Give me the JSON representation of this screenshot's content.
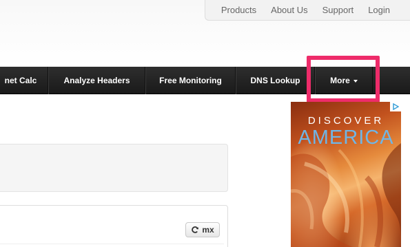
{
  "top_links": {
    "products": "Products",
    "about": "About Us",
    "support": "Support",
    "login": "Login"
  },
  "nav": {
    "subnet_calc": "net Calc",
    "analyze_headers": "Analyze Headers",
    "free_monitoring": "Free Monitoring",
    "dns_lookup": "DNS Lookup",
    "more": "More"
  },
  "toolbar": {
    "mx_label": "mx"
  },
  "ad": {
    "line1": "DISCOVER",
    "line2": "AMERICA"
  },
  "colors": {
    "highlight": "#ee2c6a",
    "navbar": "#222222",
    "ad_title_blue": "#6fb6e6"
  },
  "icons": {
    "refresh": "refresh-icon",
    "adchoices": "adchoices-icon",
    "caret": "caret-down-icon"
  }
}
